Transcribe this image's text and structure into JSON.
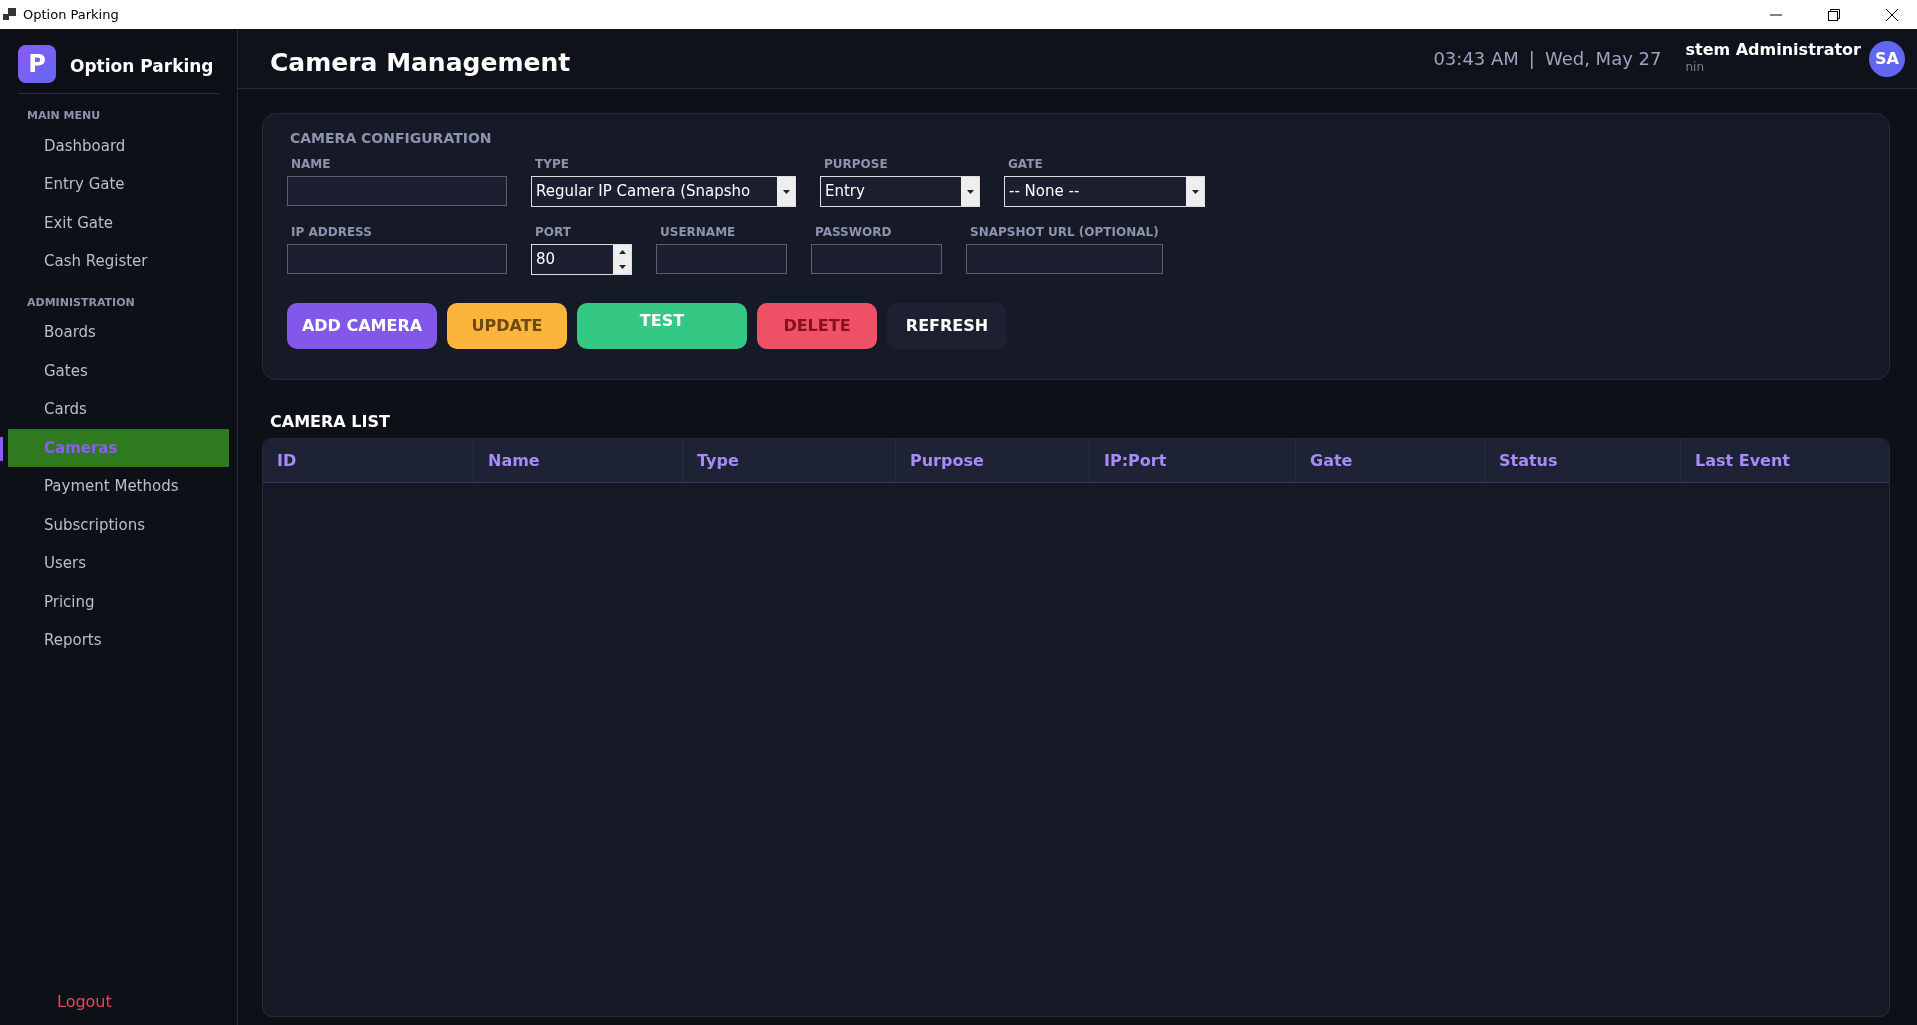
{
  "window": {
    "title": "Option Parking"
  },
  "sidebar": {
    "brand_letter": "P",
    "brand": "Option Parking",
    "sections": [
      {
        "heading": "MAIN MENU",
        "items": [
          {
            "label": "Dashboard",
            "selected": false
          },
          {
            "label": "Entry Gate",
            "selected": false
          },
          {
            "label": "Exit Gate",
            "selected": false
          },
          {
            "label": "Cash Register",
            "selected": false
          }
        ]
      },
      {
        "heading": "ADMINISTRATION",
        "items": [
          {
            "label": "Boards",
            "selected": false
          },
          {
            "label": "Gates",
            "selected": false
          },
          {
            "label": "Cards",
            "selected": false
          },
          {
            "label": "Cameras",
            "selected": true
          },
          {
            "label": "Payment Methods",
            "selected": false
          },
          {
            "label": "Subscriptions",
            "selected": false
          },
          {
            "label": "Users",
            "selected": false
          },
          {
            "label": "Pricing",
            "selected": false
          },
          {
            "label": "Reports",
            "selected": false
          }
        ]
      }
    ],
    "logout": "Logout"
  },
  "header": {
    "title": "Camera Management",
    "time": "03:43 AM",
    "separator": "|",
    "date": "Wed, May 27",
    "user_name": "stem Administrator",
    "user_role": "nin",
    "avatar": "SA"
  },
  "config": {
    "title": "CAMERA CONFIGURATION",
    "fields": [
      {
        "label": "NAME",
        "kind": "text"
      },
      {
        "label": "TYPE",
        "kind": "select",
        "value": "Regular IP Camera (Snapsho"
      },
      {
        "label": "PURPOSE",
        "kind": "select",
        "value": "Entry"
      },
      {
        "label": "GATE",
        "kind": "select",
        "value": "-- None --"
      },
      {
        "label": "IP ADDRESS",
        "kind": "text"
      },
      {
        "label": "PORT",
        "kind": "spin",
        "value": "80"
      },
      {
        "label": "USERNAME",
        "kind": "text"
      },
      {
        "label": "PASSWORD",
        "kind": "text"
      },
      {
        "label": "SNAPSHOT URL (OPTIONAL)",
        "kind": "text"
      }
    ],
    "buttons": [
      {
        "label": "ADD CAMERA",
        "kind": "primary"
      },
      {
        "label": "UPDATE",
        "kind": "warning"
      },
      {
        "label": "TEST",
        "kind": "success"
      },
      {
        "label": "DELETE",
        "kind": "danger"
      },
      {
        "label": "REFRESH",
        "kind": "dark"
      }
    ]
  },
  "camera_list": {
    "title": "CAMERA LIST",
    "columns": [
      "ID",
      "Name",
      "Type",
      "Purpose",
      "IP:Port",
      "Gate",
      "Status",
      "Last Event"
    ]
  }
}
